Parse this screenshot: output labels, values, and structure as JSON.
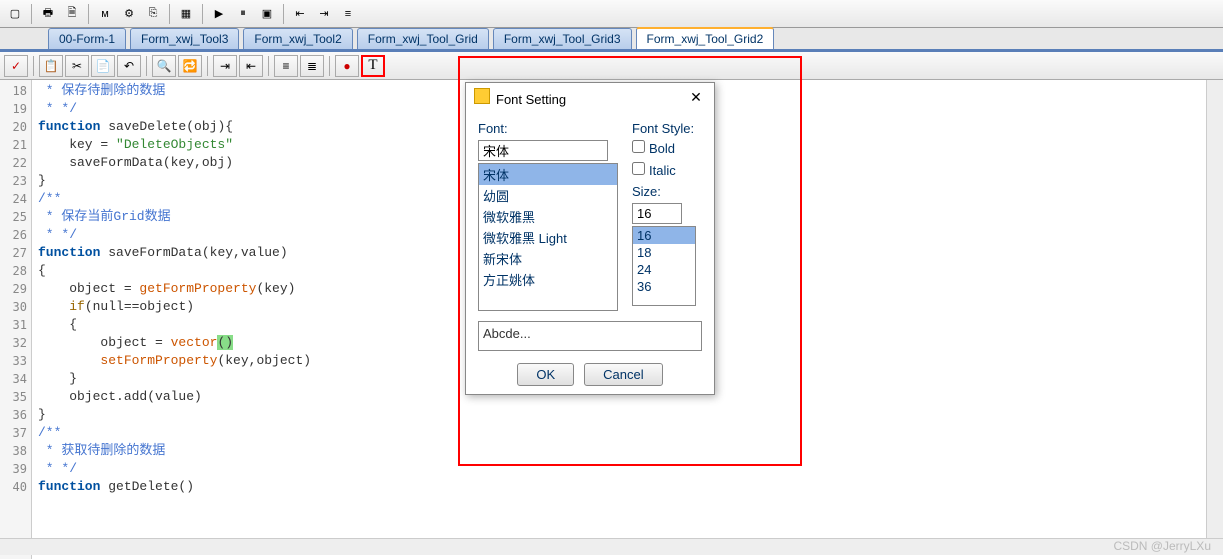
{
  "tabs": {
    "items": [
      {
        "label": "00-Form-1"
      },
      {
        "label": "Form_xwj_Tool3"
      },
      {
        "label": "Form_xwj_Tool2"
      },
      {
        "label": "Form_xwj_Tool_Grid"
      },
      {
        "label": "Form_xwj_Tool_Grid3"
      },
      {
        "label": "Form_xwj_Tool_Grid2"
      }
    ],
    "active_index": 5
  },
  "gutter": {
    "lines": [
      "18",
      "19",
      "20",
      "21",
      "22",
      "23",
      "24",
      "25",
      "26",
      "27",
      "28",
      "29",
      "30",
      "31",
      "32",
      "33",
      "34",
      "35",
      "36",
      "37",
      "38",
      "39",
      "40"
    ]
  },
  "code": {
    "l18": " * 保存待删除的数据",
    "l19": " * */",
    "l20a": "function",
    "l20b": " saveDelete(obj){",
    "l21a": "    key = ",
    "l21b": "\"DeleteObjects\"",
    "l22": "    saveFormData(key,obj)",
    "l23": "}",
    "l24": "/**",
    "l25": " * 保存当前Grid数据",
    "l26": " * */",
    "l27a": "function",
    "l27b": " saveFormData(key,value)",
    "l28": "{",
    "l29a": "    object = ",
    "l29b": "getFormProperty",
    "l29c": "(key)",
    "l30a": "    ",
    "l30b": "if",
    "l30c": "(null==object)",
    "l31": "    {",
    "l32a": "        object = ",
    "l32b": "vector",
    "l32c": "(",
    "l32d": ")",
    "l33a": "        ",
    "l33b": "setFormProperty",
    "l33c": "(key,object)",
    "l34": "    }",
    "l35": "    object.add(value)",
    "l36": "}",
    "l37": "/**",
    "l38": " * 获取待删除的数据",
    "l39": " * */",
    "l40a": "function",
    "l40b": " getDelete()"
  },
  "dialog": {
    "title": "Font Setting",
    "font_label": "Font:",
    "font_value": "宋体",
    "fonts": [
      "宋体",
      "幼圆",
      "微软雅黑",
      "微软雅黑 Light",
      "新宋体",
      "方正姚体"
    ],
    "font_sel": 0,
    "style_label": "Font Style:",
    "bold_label": "Bold",
    "italic_label": "Italic",
    "size_label": "Size:",
    "size_value": "16",
    "sizes": [
      "16",
      "18",
      "24",
      "36"
    ],
    "size_sel": 0,
    "preview": "Abcde...",
    "ok": "OK",
    "cancel": "Cancel"
  },
  "watermark": "CSDN @JerryLXu"
}
